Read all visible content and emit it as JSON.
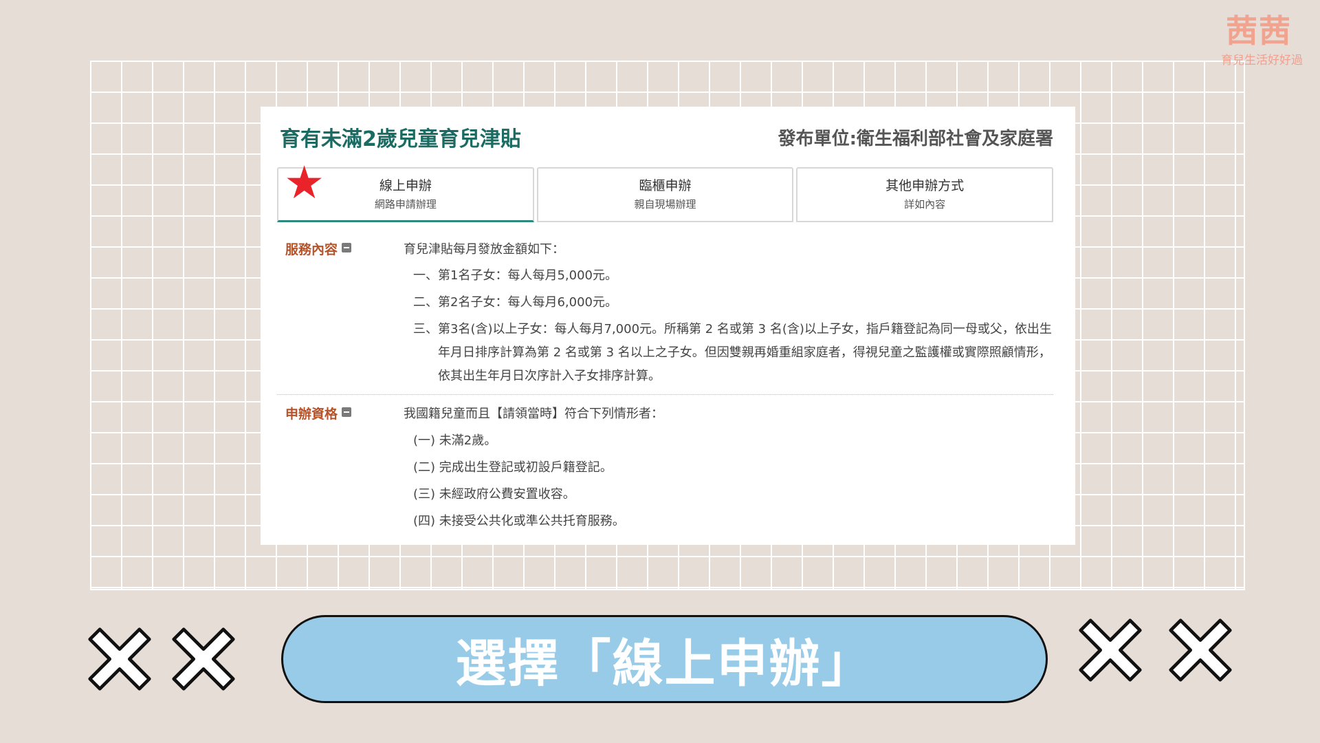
{
  "logo": {
    "mark": "茜茜",
    "tagline": "育兒生活好好過"
  },
  "card": {
    "title": "育有未滿2歲兒童育兒津貼",
    "publisher": "發布單位:衛生福利部社會及家庭署"
  },
  "tabs": [
    {
      "label": "線上申辦",
      "sub": "網路申請辦理",
      "active": true
    },
    {
      "label": "臨櫃申辦",
      "sub": "親自現場辦理",
      "active": false
    },
    {
      "label": "其他申辦方式",
      "sub": "詳如內容",
      "active": false
    }
  ],
  "service": {
    "label": "服務內容",
    "lead": "育兒津貼每月發放金額如下：",
    "items": [
      "一、第1名子女：每人每月5,000元。",
      "二、第2名子女：每人每月6,000元。"
    ],
    "item3_prefix": "三、",
    "item3_text": "第3名(含)以上子女：每人每月7,000元。所稱第 2 名或第 3 名(含)以上子女，指戶籍登記為同一母或父，依出生年月日排序計算為第 2 名或第 3 名以上之子女。但因雙親再婚重組家庭者，得視兒童之監護權或實際照顧情形，依其出生年月日次序計入子女排序計算。"
  },
  "eligibility": {
    "label": "申辦資格",
    "lead": "我國籍兒童而且【請領當時】符合下列情形者：",
    "items": [
      "(一) 未滿2歲。",
      "(二) 完成出生登記或初設戶籍登記。",
      "(三) 未經政府公費安置收容。",
      "(四) 未接受公共化或準公共托育服務。"
    ]
  },
  "banner": {
    "text": "選擇「線上申辦」"
  },
  "colors": {
    "background": "#e6ddd6",
    "title_green": "#1b6b63",
    "label_brown": "#b5532a",
    "star_red": "#e8242a",
    "banner_blue": "#97cbe7"
  },
  "icons": {
    "star": "star-icon",
    "collapse": "minus-square-icon",
    "decoration": "x-cross-icon"
  }
}
